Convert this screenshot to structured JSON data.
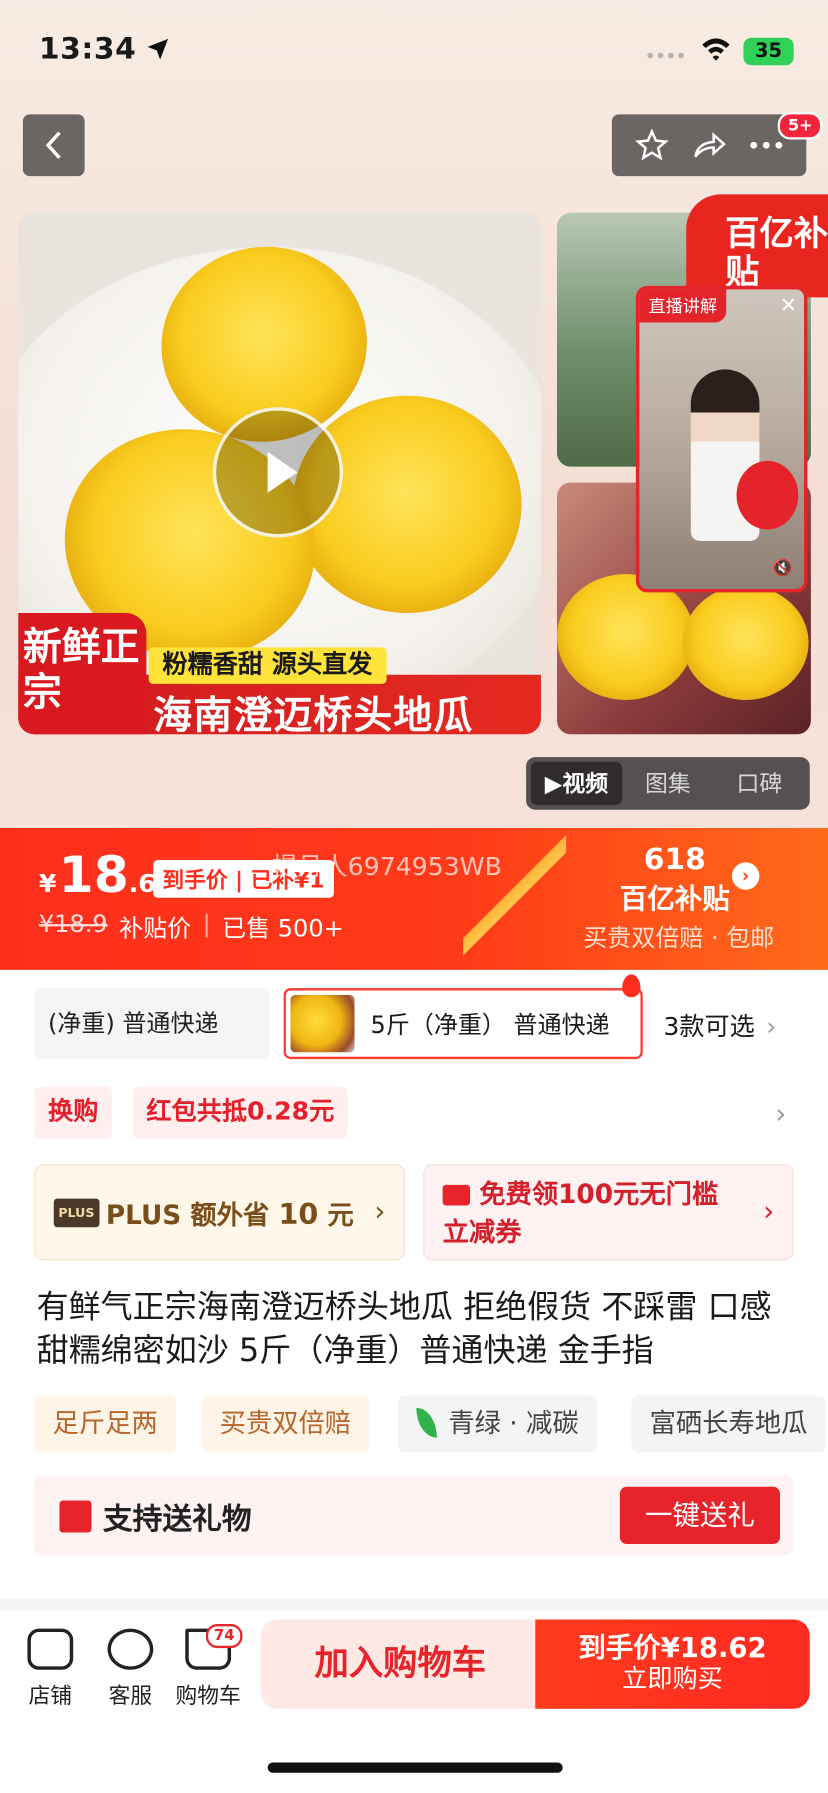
{
  "status": {
    "time": "13:34",
    "battery": "35"
  },
  "header": {
    "back_icon": "chevron-left-icon",
    "badge": "5+"
  },
  "gallery": {
    "fresh_tag": "新鲜正宗",
    "slogan": "粉糯香甜 源头直发",
    "product_banner": "海南澄迈桥头地瓜",
    "subsidy_badge": "百亿补贴",
    "live_label": "直播讲解",
    "tabs": [
      "▶视频",
      "图集",
      "口碑"
    ]
  },
  "price": {
    "currency": "¥",
    "integer": "18",
    "decimal": ".62",
    "chip": "到手价 | 已补¥1",
    "watermark": "提月人6974953WB",
    "original": "¥18.9",
    "subsidy_label": "补贴价",
    "sold": "已售 500+",
    "promo_618": "618",
    "promo_brand": "百亿补贴",
    "promo_sub": "买贵双倍赔 · 包邮"
  },
  "spec": {
    "option1": "(净重)  普通快递",
    "option2": "5斤（净重） 普通快递",
    "more": "3款可选"
  },
  "promos": {
    "exchange": "换购",
    "redpacket": "红包共抵0.28元"
  },
  "plus": {
    "logo": "PLUS",
    "text_prefix": "PLUS 额外省",
    "amount": "10",
    "unit": "元"
  },
  "coupon": {
    "line1": "免费领100元无门槛",
    "line2": "立减券"
  },
  "product": {
    "title": "有鲜气正宗海南澄迈桥头地瓜 拒绝假货 不踩雷 口感甜糯绵密如沙 5斤（净重）普通快递 金手指"
  },
  "features": [
    "足斤足两",
    "买贵双倍赔",
    "青绿 · 减碳",
    "富硒长寿地瓜"
  ],
  "gift": {
    "text": "支持送礼物",
    "button": "一键送礼"
  },
  "bottom": {
    "shop": "店铺",
    "service": "客服",
    "cart": "购物车",
    "cart_count": "74",
    "add_cart": "加入购物车",
    "buy_price": "到手价¥18.62",
    "buy_now": "立即购买"
  }
}
